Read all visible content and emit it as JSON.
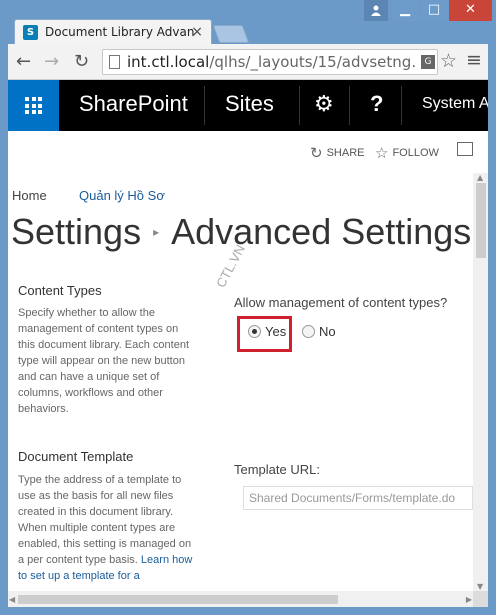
{
  "browser": {
    "tab_title": "Document Library Advanc",
    "tab_close": "×",
    "url_host": "int.ctl.local",
    "url_path": "/qlhs/_layouts/15/advsetng.as",
    "window_buttons": {
      "minimize": "▁",
      "maximize": "□",
      "close": "✕"
    }
  },
  "suitebar": {
    "brand": "SharePoint",
    "sites": "Sites",
    "help": "?",
    "user": "System Ac"
  },
  "actions": {
    "share": "SHARE",
    "follow": "FOLLOW"
  },
  "breadcrumb": {
    "home": "Home",
    "library": "Quản lý Hồ Sơ"
  },
  "title": {
    "part1": "Settings",
    "part2": "Advanced Settings"
  },
  "content_types": {
    "title": "Content Types",
    "description": "Specify whether to allow the management of content types on this document library. Each content type will appear on the new button and can have a unique set of columns, workflows and other behaviors.",
    "question": "Allow management of content types?",
    "yes": "Yes",
    "no": "No",
    "selected": "yes"
  },
  "document_template": {
    "title": "Document Template",
    "description": "Type the address of a template to use as the basis for all new files created in this document library. When multiple content types are enabled, this setting is managed on a per content type basis.",
    "link": "Learn how to set up a template for a",
    "label": "Template URL:",
    "value": "Shared Documents/Forms/template.do"
  },
  "watermark": "CTL.VN",
  "colors": {
    "suitebar": "#000000",
    "waffle": "#0072c6",
    "link": "#1a5c9a",
    "highlight": "#d0202e"
  }
}
